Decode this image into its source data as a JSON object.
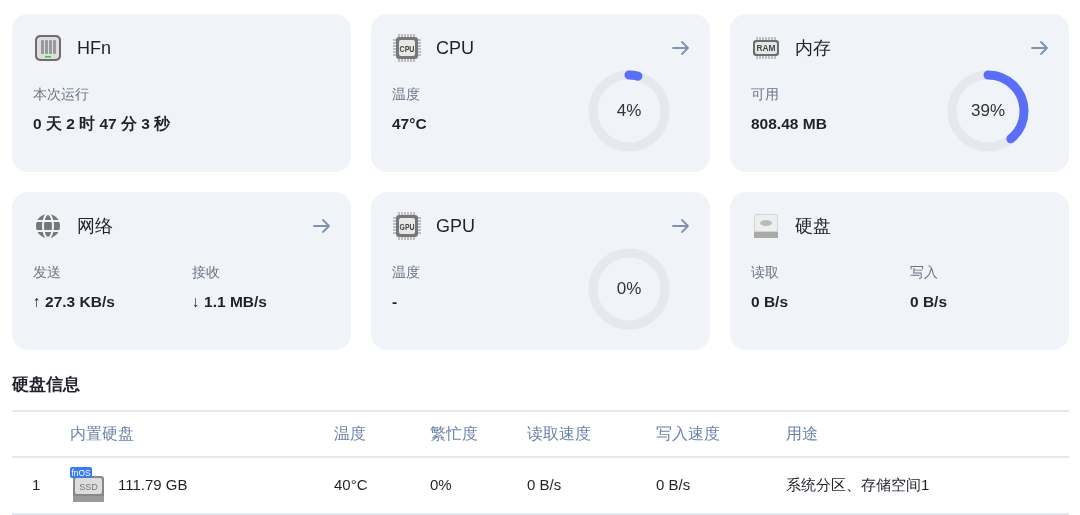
{
  "cards": [
    {
      "kind": "nas",
      "title": "HFn",
      "link": false,
      "stats": [
        {
          "label": "本次运行",
          "value": "0 天 2 时 47 分 3 秒"
        }
      ]
    },
    {
      "kind": "cpu",
      "icon_label": "CPU",
      "title": "CPU",
      "link": true,
      "stats": [
        {
          "label": "温度",
          "value": "47°C"
        }
      ],
      "gauge": {
        "reading": "4%"
      }
    },
    {
      "kind": "ram",
      "icon_label": "RAM",
      "title": "内存",
      "link": true,
      "stats": [
        {
          "label": "可用",
          "value": "808.48 MB"
        }
      ],
      "gauge": {
        "reading": "39%"
      }
    },
    {
      "kind": "network",
      "title": "网络",
      "link": true,
      "stats": [
        {
          "label": "发送",
          "value": "↑ 27.3 KB/s"
        },
        {
          "label": "接收",
          "value": "↓ 1.1 MB/s"
        }
      ]
    },
    {
      "kind": "gpu",
      "icon_label": "GPU",
      "title": "GPU",
      "link": true,
      "stats": [
        {
          "label": "温度",
          "value": "-"
        }
      ],
      "gauge": {
        "reading": "0%"
      }
    },
    {
      "kind": "disk",
      "title": "硬盘",
      "link": false,
      "stats": [
        {
          "label": "读取",
          "value": "0 B/s"
        },
        {
          "label": "写入",
          "value": "0 B/s"
        }
      ]
    }
  ],
  "disk_info": {
    "title": "硬盘信息",
    "columns": [
      "",
      "内置硬盘",
      "温度",
      "繁忙度",
      "读取速度",
      "写入速度",
      "用途"
    ],
    "rows": [
      {
        "badge": "fnOS",
        "icon_label": "SSD",
        "cells": [
          "1",
          "111.79 GB",
          "40°C",
          "0%",
          "0 B/s",
          "0 B/s",
          "系统分区、存储空间1"
        ]
      }
    ]
  }
}
